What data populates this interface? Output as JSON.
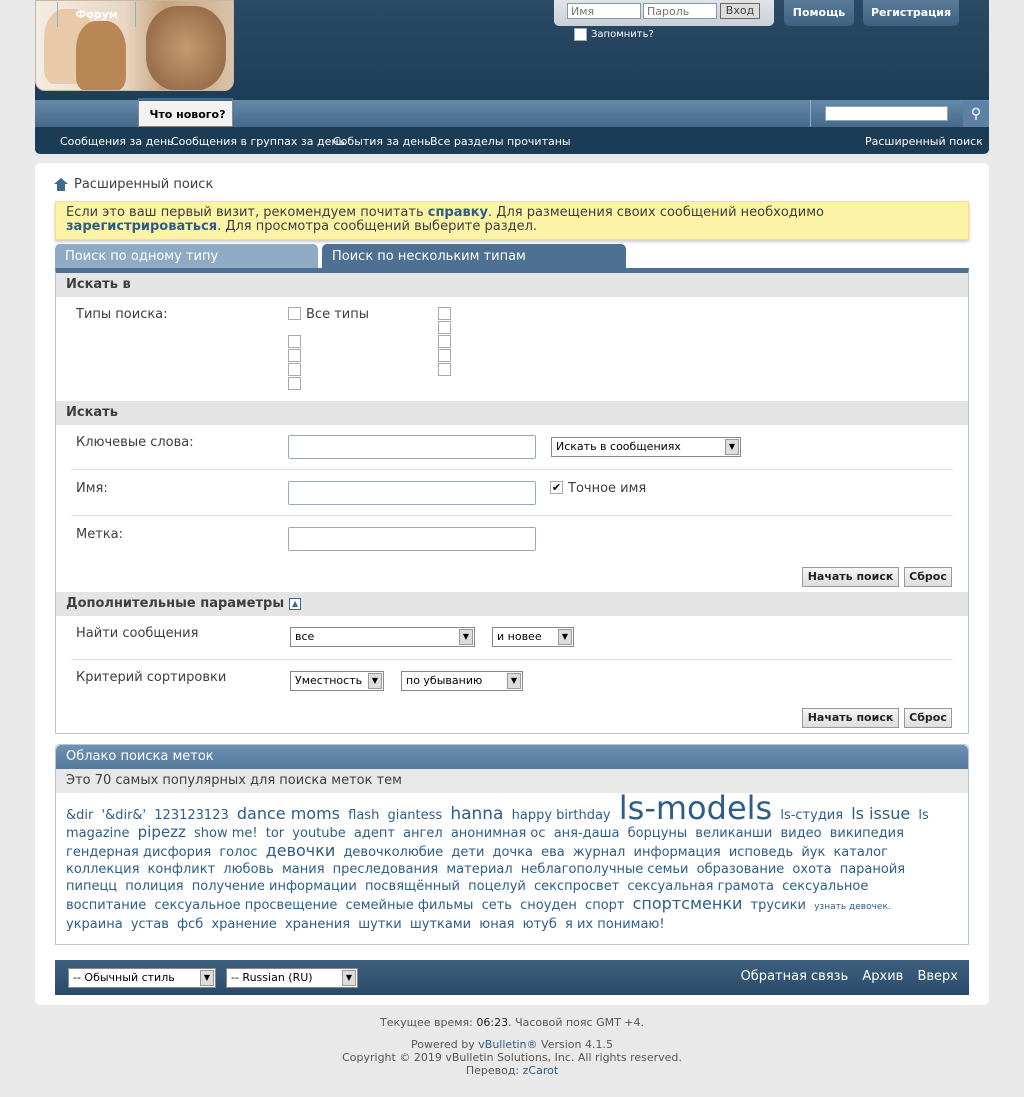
{
  "login": {
    "username_placeholder": "Имя",
    "password_placeholder": "Пароль",
    "login_button": "Вход",
    "remember_label": "Запомнить?"
  },
  "top_buttons": {
    "help": "Помощь",
    "register": "Регистрация"
  },
  "nav": {
    "tab_forum": "Форум",
    "tab_whats_new": "Что нового?"
  },
  "subnav": {
    "item1": "Сообщения за день",
    "item2": "Сообщения в группах за день",
    "item3": "События за день",
    "item4": "Все разделы прочитаны",
    "advanced": "Расширенный поиск"
  },
  "breadcrumb": "Расширенный поиск",
  "notice": {
    "p1": "Если это ваш первый визит, рекомендуем почитать ",
    "link1": "справку",
    "p2": ". Для размещения своих сообщений необходимо ",
    "link2": "зарегистрироваться",
    "p3": ". Для просмотра сообщений выберите раздел."
  },
  "tabs": {
    "single": "Поиск по одному типу содержимого",
    "multi": "Поиск по нескольким типам содержимого"
  },
  "search_in": {
    "header": "Искать в",
    "types_label": "Типы поиска:",
    "all_types": "Все типы"
  },
  "search": {
    "header": "Искать",
    "keywords_label": "Ключевые слова:",
    "search_in_select": "Искать в сообщениях",
    "name_label": "Имя:",
    "exact_name": "Точное имя",
    "tag_label": "Метка:",
    "start_button": "Начать поиск",
    "reset_button": "Сброс"
  },
  "additional": {
    "header": "Дополнительные параметры",
    "find_label": "Найти сообщения",
    "find_select": "все",
    "newer_select": "и новее",
    "sort_label": "Критерий сортировки",
    "sort_select": "Уместность",
    "order_select": "по убыванию"
  },
  "tag_cloud": {
    "header": "Облако поиска меток",
    "subheader": "Это 70 самых популярных для поиска меток тем",
    "tags": [
      {
        "t": "&dir",
        "s": 13
      },
      {
        "t": "'&dir&'",
        "s": 13
      },
      {
        "t": "123123123",
        "s": 13
      },
      {
        "t": "dance moms",
        "s": 16
      },
      {
        "t": "flash",
        "s": 13
      },
      {
        "t": "giantess",
        "s": 13
      },
      {
        "t": "hanna",
        "s": 17
      },
      {
        "t": "happy birthday",
        "s": 13
      },
      {
        "t": "ls-models",
        "s": 32
      },
      {
        "t": "ls-студия",
        "s": 13
      },
      {
        "t": "ls issue",
        "s": 16
      },
      {
        "t": "ls magazine",
        "s": 13
      },
      {
        "t": "pipezz",
        "s": 15
      },
      {
        "t": "show me!",
        "s": 13
      },
      {
        "t": "tor",
        "s": 13
      },
      {
        "t": "youtube",
        "s": 13
      },
      {
        "t": "адепт",
        "s": 13
      },
      {
        "t": "ангел",
        "s": 13
      },
      {
        "t": "анонимная ос",
        "s": 13
      },
      {
        "t": "аня-даша",
        "s": 13
      },
      {
        "t": "борцуны",
        "s": 13
      },
      {
        "t": "великанши",
        "s": 13
      },
      {
        "t": "видео",
        "s": 13
      },
      {
        "t": "википедия",
        "s": 13
      },
      {
        "t": "гендерная дисфория",
        "s": 13
      },
      {
        "t": "голос",
        "s": 13
      },
      {
        "t": "девочки",
        "s": 16
      },
      {
        "t": "девочколюбие",
        "s": 13
      },
      {
        "t": "дети",
        "s": 13
      },
      {
        "t": "дочка",
        "s": 13
      },
      {
        "t": "ева",
        "s": 13
      },
      {
        "t": "журнал",
        "s": 13
      },
      {
        "t": "информация",
        "s": 13
      },
      {
        "t": "исповедь",
        "s": 13
      },
      {
        "t": "йук",
        "s": 13
      },
      {
        "t": "каталог",
        "s": 13
      },
      {
        "t": "коллекция",
        "s": 13
      },
      {
        "t": "конфликт",
        "s": 13
      },
      {
        "t": "любовь",
        "s": 13
      },
      {
        "t": "мания",
        "s": 13
      },
      {
        "t": "преследования",
        "s": 13
      },
      {
        "t": "материал",
        "s": 13
      },
      {
        "t": "неблагополучные семьи",
        "s": 13
      },
      {
        "t": "образование",
        "s": 13
      },
      {
        "t": "охота",
        "s": 13
      },
      {
        "t": "паранойя",
        "s": 13
      },
      {
        "t": "пипецц",
        "s": 13
      },
      {
        "t": "полиция",
        "s": 13
      },
      {
        "t": "получение информации",
        "s": 13
      },
      {
        "t": "посвящённый",
        "s": 13
      },
      {
        "t": "поцелуй",
        "s": 13
      },
      {
        "t": "секспросвет",
        "s": 13
      },
      {
        "t": "сексуальная грамота",
        "s": 13
      },
      {
        "t": "сексуальное воспитание",
        "s": 13
      },
      {
        "t": "сексуальное просвещение",
        "s": 13
      },
      {
        "t": "семейные фильмы",
        "s": 13
      },
      {
        "t": "сеть",
        "s": 13
      },
      {
        "t": "сноуден",
        "s": 13
      },
      {
        "t": "спорт",
        "s": 13
      },
      {
        "t": "спортсменки",
        "s": 16
      },
      {
        "t": "трусики",
        "s": 13
      },
      {
        "t": "узнать девочек.",
        "s": 9
      },
      {
        "t": "украина",
        "s": 13
      },
      {
        "t": "устав",
        "s": 13
      },
      {
        "t": "фсб",
        "s": 13
      },
      {
        "t": "хранение",
        "s": 13
      },
      {
        "t": "хранения",
        "s": 13
      },
      {
        "t": "шутки",
        "s": 13
      },
      {
        "t": "шутками",
        "s": 13
      },
      {
        "t": "юная",
        "s": 13
      },
      {
        "t": "ютуб",
        "s": 13
      },
      {
        "t": "я их понимаю!",
        "s": 13
      }
    ]
  },
  "footer": {
    "style_select": "-- Обычный стиль",
    "lang_select": "-- Russian (RU)",
    "feedback": "Обратная связь",
    "archive": "Архив",
    "top": "Вверх"
  },
  "bottom": {
    "time_prefix": "Текущее время: ",
    "time": "06:23",
    "time_suffix": ". Часовой пояс GMT +4.",
    "powered_prefix": "Powered by ",
    "vb": "vBulletin®",
    "powered_suffix": " Version 4.1.5",
    "copyright": "Copyright © 2019 vBulletin Solutions, Inc. All rights reserved.",
    "translation_prefix": "Перевод: ",
    "translator": "zCarot"
  }
}
